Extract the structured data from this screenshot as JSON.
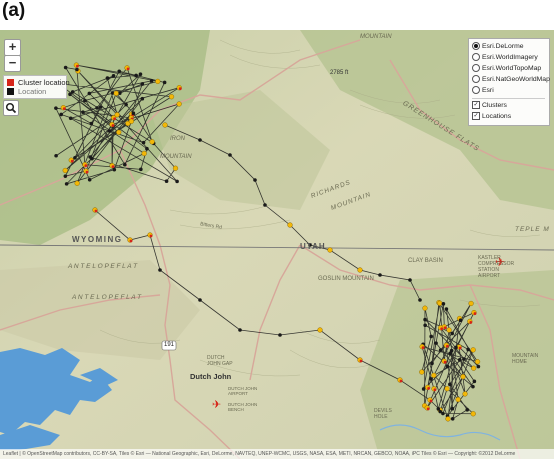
{
  "figure_label": "(a)",
  "colors": {
    "cluster": "#d62418",
    "location": "#f2b707",
    "track": "#1a1a1a",
    "water": "#5a9cd6",
    "road": "#d7a79a",
    "state_line": "#777777"
  },
  "zoom": {
    "in_label": "+",
    "out_label": "−"
  },
  "legend": {
    "cluster_label": "Cluster location",
    "location_label": "Location"
  },
  "search": {
    "icon": "search-icon"
  },
  "layers": {
    "basemaps": [
      {
        "label": "Esri.DeLorme",
        "selected": true
      },
      {
        "label": "Esri.WorldImagery",
        "selected": false
      },
      {
        "label": "Esri.WorldTopoMap",
        "selected": false
      },
      {
        "label": "Esri.NatGeoWorldMap",
        "selected": false
      },
      {
        "label": "Esri",
        "selected": false
      }
    ],
    "overlays": [
      {
        "label": "Clusters",
        "checked": true
      },
      {
        "label": "Locations",
        "checked": true
      }
    ]
  },
  "map_labels": {
    "mountain": "MOUNTAIN",
    "elev_2785": "2785 ft",
    "greenhouse": "GREENHOUSE FLATS",
    "iron": "IRON",
    "mountain2": "MOUNTAIN",
    "richards": "RICHARDS",
    "richards_mtn": "MOUNTAIN",
    "wyoming": "WYOMING",
    "utah": "UTAH",
    "antelope1": "A N T E L O P E   F L A T",
    "antelope2": "A N T E L O P E   F L A T",
    "goslin": "GOSLIN MOUNTAIN",
    "clay_basin": "CLAY BASIN",
    "kastler": "KASTLER COMPRESSOR STATION AIRPORT",
    "dutch_john_gap": "DUTCH JOHN GAP",
    "dutch_john": "Dutch John",
    "dj_airport": "DUTCH JOHN AIRPORT",
    "dj_bench": "DUTCH JOHN BENCH",
    "hwy": "191",
    "mtn_home": "MOUNTAIN HOME",
    "devils_hole": "DEVILS HOLE",
    "teple": "TEPLE M",
    "bitters": "Bitters Rd",
    "rd_label": "Bitters Ra"
  },
  "attribution": "Leaflet | © OpenStreetMap contributors, CC-BY-SA, Tiles © Esri — National Geographic, Esri, DeLorme, NAVTEQ, UNEP-WCMC, USGS, NASA, ESA, METI, NRCAN, GEBCO, NOAA, iPC Tiles © Esri — Copyright: ©2012 DeLorme"
}
